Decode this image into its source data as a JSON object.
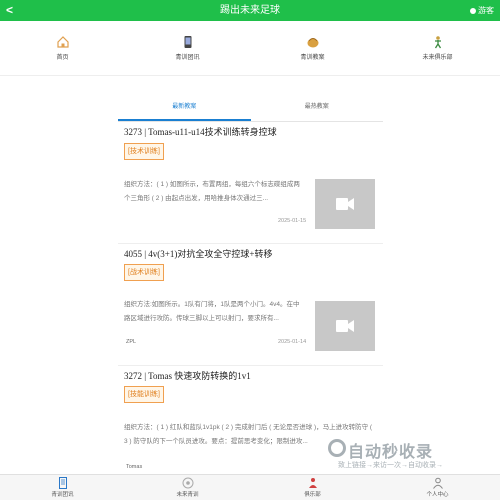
{
  "topbar": {
    "back": "<",
    "title": "踢出未来足球",
    "guest": "游客"
  },
  "nav": [
    {
      "label": "首页",
      "icon": "home-icon"
    },
    {
      "label": "青训团讯",
      "icon": "phone-icon"
    },
    {
      "label": "青训教案",
      "icon": "basket-icon"
    },
    {
      "label": "未来俱乐部",
      "icon": "player-icon"
    }
  ],
  "tabs": {
    "latest": "最新教案",
    "hottest": "最热教案"
  },
  "cards": [
    {
      "title": "3273 | Tomas-u11-u14技术训练转身控球",
      "badge": "[技术训练]",
      "desc": "组织方法：( 1 ) 如图所示，布置两组，每组六个标志碟组成两个三角形 ( 2 ) 由起点出发，用哈推身体次通过三...",
      "date": "2025-01-15",
      "author": ""
    },
    {
      "title": "4055 | 4v(3+1)对抗全攻全守控球+转移",
      "badge": "[战术训练]",
      "desc": "组织方法:如图所示。1队有门将，1队是两个小门。4v4。在中路区域进行攻防。传球三脚以上可以射门，要求所有...",
      "date": "2025-01-14",
      "author": "ZPL"
    },
    {
      "title": "3272 | Tomas 快速攻防转换的1v1",
      "badge": "[技能训练]",
      "desc": "组织方法：( 1 ) 红队和蓝队1v1pk ( 2 ) 完成射门后 ( 无论是否进球 )，马上进攻转防守 ( 3 ) 防守队的下一个队员进攻。要点：提前思考变化；限制进攻...",
      "date": "",
      "author": "Tomas"
    }
  ],
  "bottom_tabs": [
    {
      "label": "青训团讯",
      "icon": "doc-icon"
    },
    {
      "label": "未来青训",
      "icon": "ball-icon"
    },
    {
      "label": "俱乐部",
      "icon": "club-icon"
    },
    {
      "label": "个人中心",
      "icon": "user-icon"
    }
  ],
  "watermark": {
    "main": "自动秒收录",
    "sub": "致上链接→来访一次→自动收录→"
  },
  "colors": {
    "primary": "#1fbf4a",
    "accent": "#1a7fd1",
    "badge": "#e08020"
  }
}
